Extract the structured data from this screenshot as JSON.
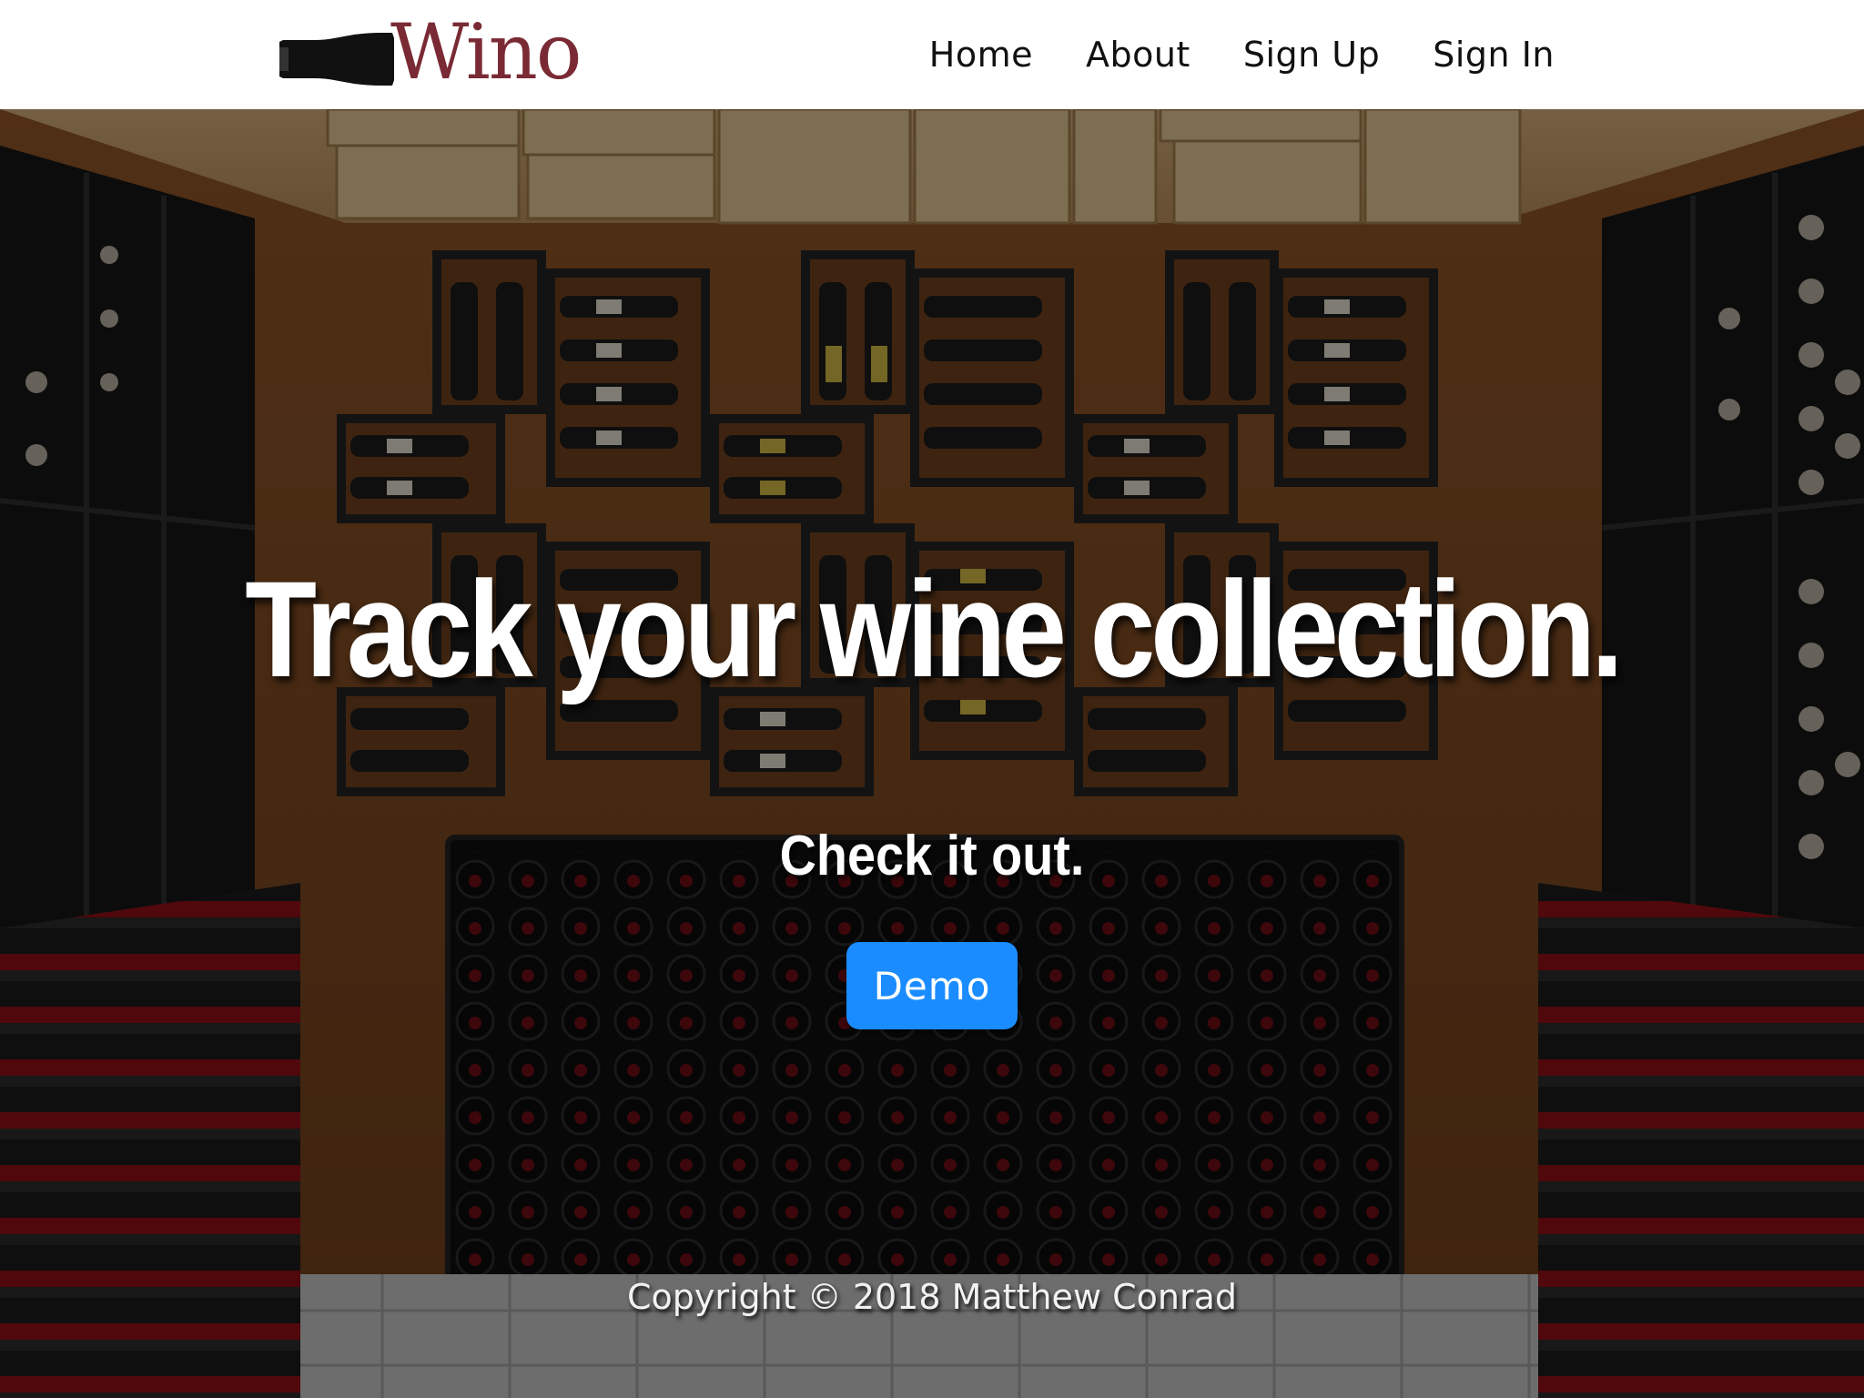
{
  "nav": {
    "brand": "Wino",
    "links": [
      "Home",
      "About",
      "Sign Up",
      "Sign In"
    ]
  },
  "hero": {
    "headline": "Track your wine collection.",
    "subhead": "Check it out.",
    "cta_label": "Demo"
  },
  "footer": {
    "copyright": "Copyright © 2018 Matthew Conrad"
  },
  "colors": {
    "brand": "#7a2a34",
    "button": "#1a8cff",
    "navbar_bg": "#ffffff"
  },
  "icons": {
    "brand_logo": "wine-bottle-icon"
  }
}
